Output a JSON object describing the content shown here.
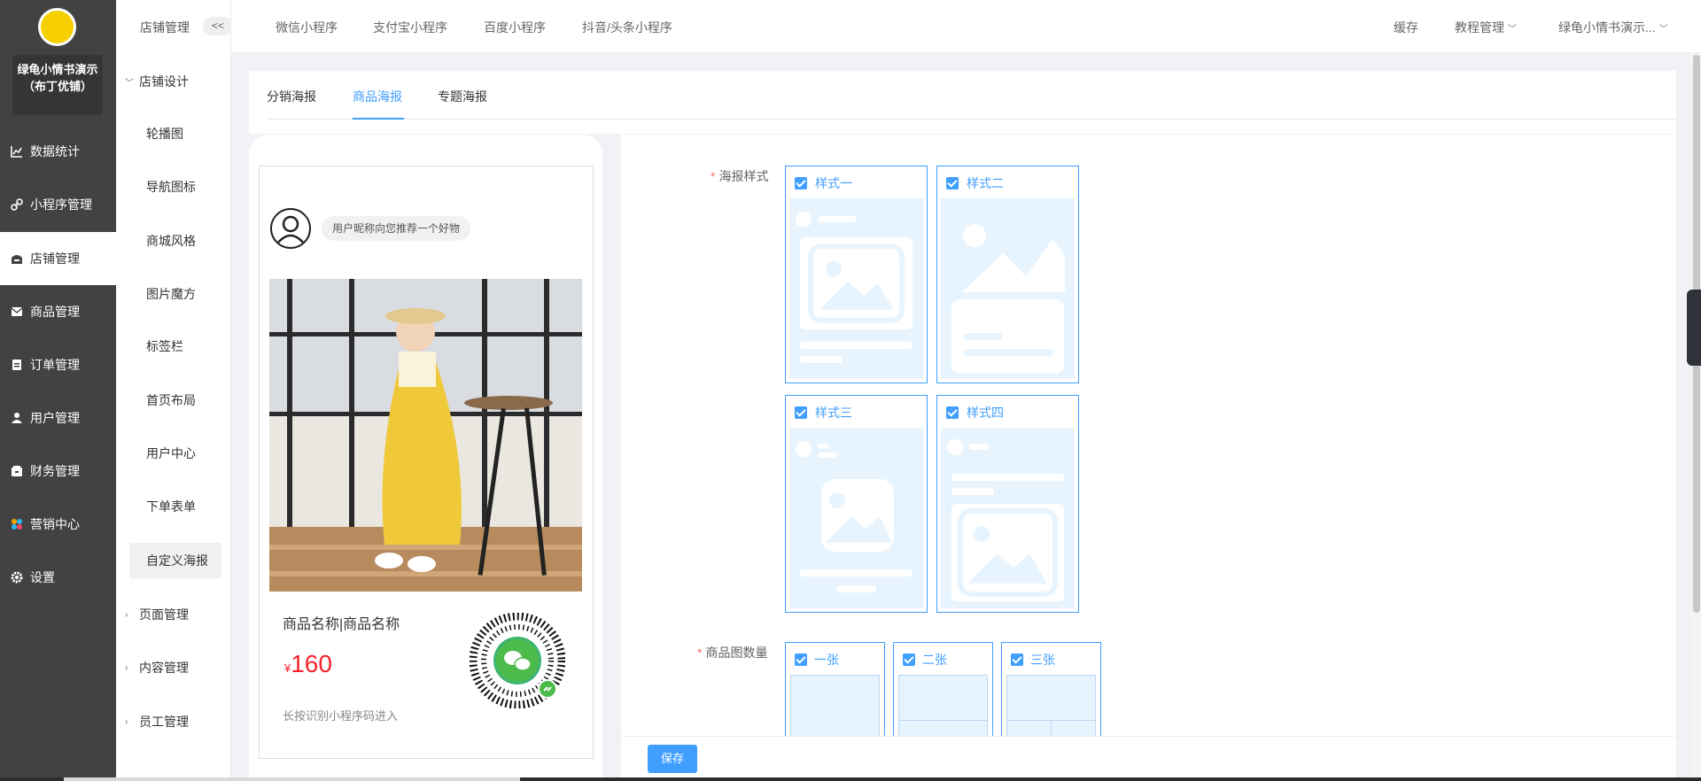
{
  "shop": {
    "name": "绿龟小情书演示（布丁优铺）"
  },
  "main_nav": [
    {
      "label": "数据统计",
      "icon": "chart-line-icon"
    },
    {
      "label": "小程序管理",
      "icon": "link-icon"
    },
    {
      "label": "店铺管理",
      "icon": "store-icon",
      "active": true
    },
    {
      "label": "商品管理",
      "icon": "envelope-icon"
    },
    {
      "label": "订单管理",
      "icon": "clipboard-icon"
    },
    {
      "label": "用户管理",
      "icon": "user-icon"
    },
    {
      "label": "财务管理",
      "icon": "wallet-icon"
    },
    {
      "label": "营销中心",
      "icon": "puzzle-icon"
    },
    {
      "label": "设置",
      "icon": "gear-icon"
    }
  ],
  "sub_nav": {
    "title": "店铺管理",
    "collapse_label": "<<",
    "group_store_design": "店铺设计",
    "items": [
      "轮播图",
      "导航图标",
      "商城风格",
      "图片魔方",
      "标签栏",
      "首页布局",
      "用户中心",
      "下单表单",
      "自定义海报"
    ],
    "active_item": "自定义海报",
    "group_pages": "页面管理",
    "group_content": "内容管理",
    "group_staff": "员工管理"
  },
  "top_tabs": [
    "微信小程序",
    "支付宝小程序",
    "百度小程序",
    "抖音/头条小程序"
  ],
  "top_right": {
    "cache": "缓存",
    "tutorial": "教程管理",
    "account": "绿龟小情书演示..."
  },
  "poster_tabs": [
    "分销海报",
    "商品海报",
    "专题海报"
  ],
  "active_poster_tab": "商品海报",
  "preview": {
    "recommend_text": "用户昵称向您推荐一个好物",
    "goods_name": "商品名称|商品名称",
    "currency": "¥",
    "price": "160",
    "tip": "长按识别小程序码进入"
  },
  "form": {
    "style_label": "海报样式",
    "styles": [
      "样式一",
      "样式二",
      "样式三",
      "样式四"
    ],
    "count_label": "商品图数量",
    "counts": [
      "一张",
      "二张",
      "三张"
    ]
  },
  "save_label": "保存",
  "colors": {
    "primary": "#409eff",
    "sidebar": "#424243",
    "price": "#f5222d",
    "thumb_bg": "#e8f4fd"
  }
}
